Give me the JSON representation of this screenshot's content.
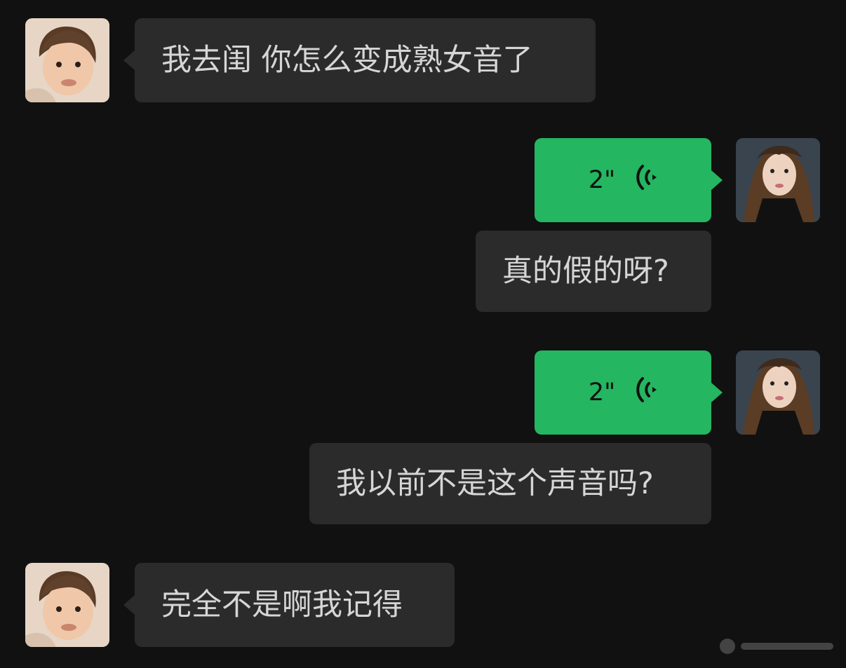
{
  "messages": [
    {
      "side": "left",
      "type": "text",
      "text": "我去闺 你怎么变成熟女音了"
    },
    {
      "side": "right",
      "type": "voice",
      "duration": "2\""
    },
    {
      "side": "right",
      "type": "text",
      "text": "真的假的呀?"
    },
    {
      "side": "right",
      "type": "voice",
      "duration": "2\""
    },
    {
      "side": "right",
      "type": "text",
      "text": "我以前不是这个声音吗?"
    },
    {
      "side": "left",
      "type": "text",
      "text": "完全不是啊我记得"
    }
  ],
  "colors": {
    "background": "#111111",
    "incoming_bubble": "#2b2b2b",
    "voice_bubble": "#24b660",
    "text": "#d6d6d6"
  },
  "icons": {
    "voice": "voice-wave-icon",
    "avatar_left": "child-avatar",
    "avatar_right": "woman-avatar"
  }
}
